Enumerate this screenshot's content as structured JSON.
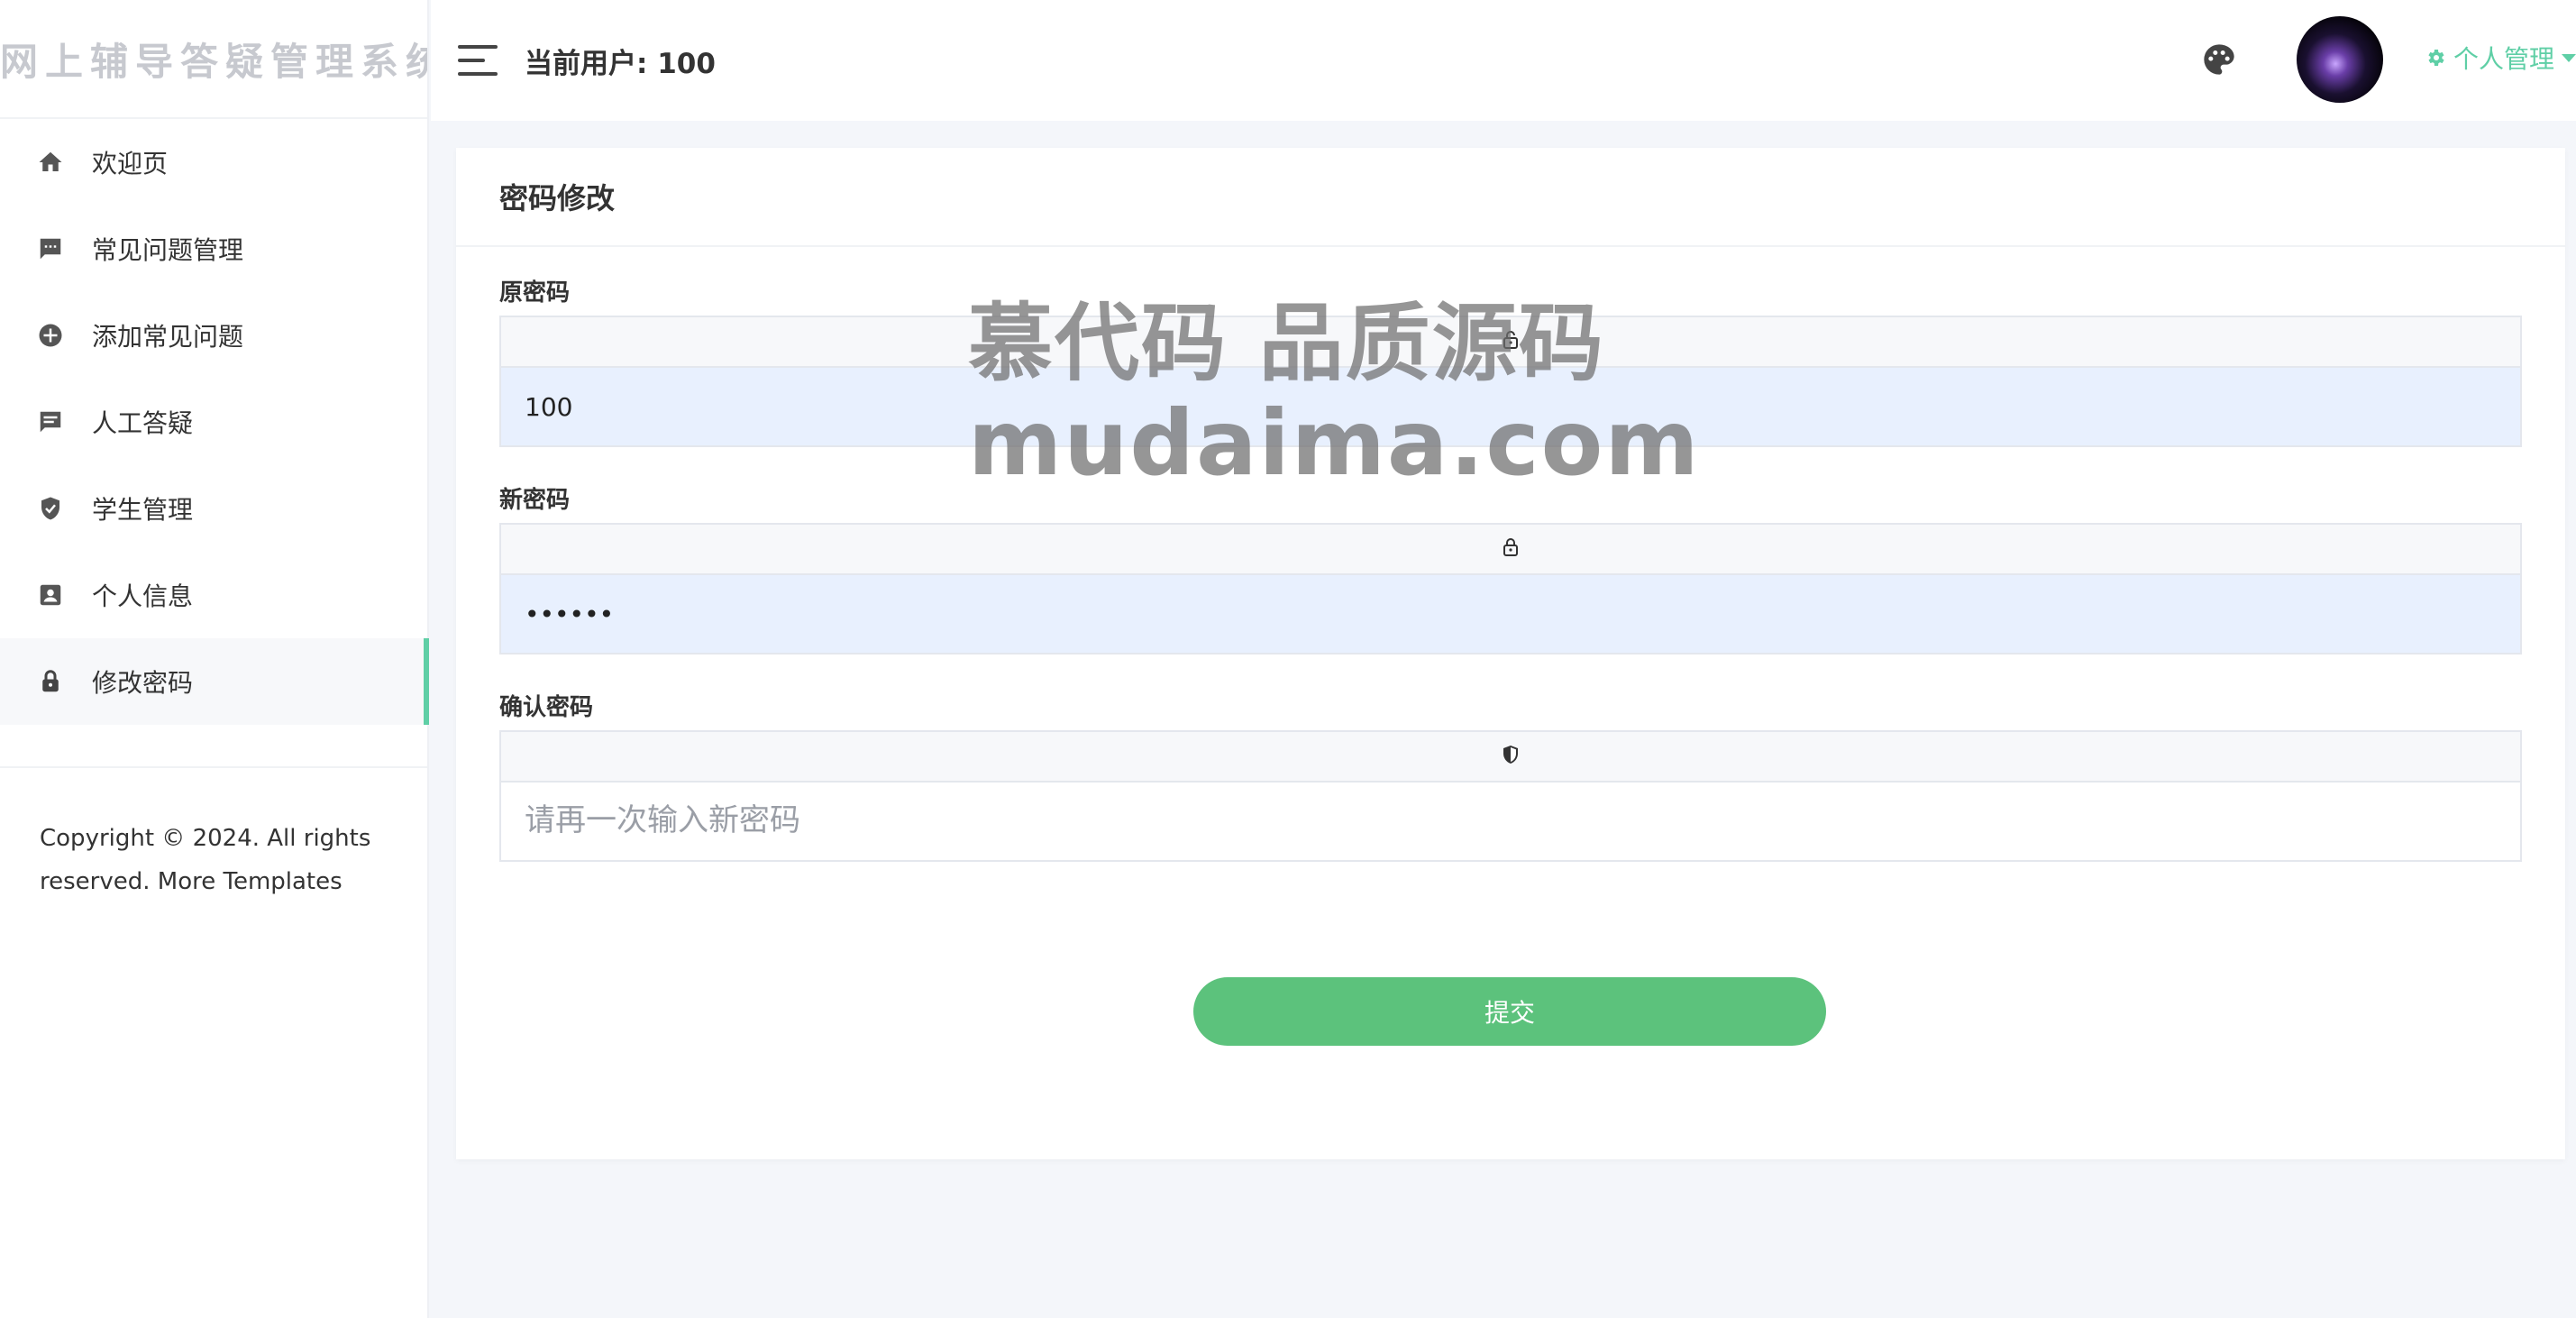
{
  "app": {
    "title": "网上辅导答疑管理系统"
  },
  "sidebar": {
    "items": [
      {
        "label": "欢迎页",
        "icon": "home-icon"
      },
      {
        "label": "常见问题管理",
        "icon": "chat-icon"
      },
      {
        "label": "添加常见问题",
        "icon": "plus-circle-icon"
      },
      {
        "label": "人工答疑",
        "icon": "message-icon"
      },
      {
        "label": "学生管理",
        "icon": "shield-check-icon"
      },
      {
        "label": "个人信息",
        "icon": "contact-card-icon"
      },
      {
        "label": "修改密码",
        "icon": "lock-icon",
        "active": true
      }
    ],
    "copyright": "Copyright © 2024. All rights reserved. More Templates"
  },
  "header": {
    "current_user": "当前用户: 100",
    "personal_menu": "个人管理",
    "accent_color": "#5fcfa6"
  },
  "form": {
    "title": "密码修改",
    "old_password": {
      "label": "原密码",
      "value": "100",
      "icon": "lock-open-icon"
    },
    "new_password": {
      "label": "新密码",
      "value": "••••••",
      "icon": "lock-icon"
    },
    "confirm_password": {
      "label": "确认密码",
      "value": "",
      "placeholder": "请再一次输入新密码",
      "icon": "shield-icon"
    },
    "submit_label": "提交",
    "submit_color": "#5cc27c"
  },
  "watermark": {
    "line1": "慕代码 品质源码",
    "line2": "mudaima.com"
  }
}
